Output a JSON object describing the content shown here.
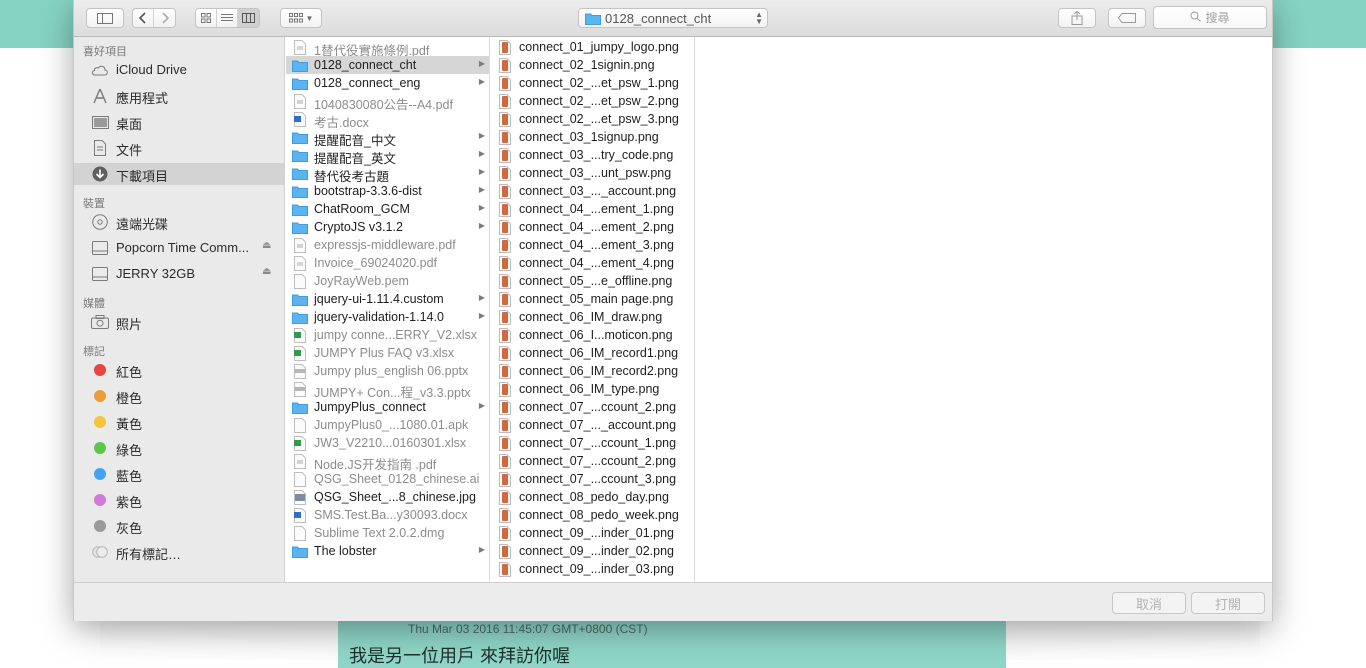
{
  "toolbar": {
    "path_label": "0128_connect_cht",
    "search_placeholder": "搜尋"
  },
  "sidebar": {
    "sections": [
      {
        "title": "喜好項目",
        "items": [
          {
            "label": "iCloud Drive",
            "icon": "cloud-icon"
          },
          {
            "label": "應用程式",
            "icon": "applications-icon"
          },
          {
            "label": "桌面",
            "icon": "desktop-icon"
          },
          {
            "label": "文件",
            "icon": "documents-icon"
          },
          {
            "label": "下載項目",
            "icon": "downloads-icon",
            "selected": true
          }
        ]
      },
      {
        "title": "裝置",
        "items": [
          {
            "label": "遠端光碟",
            "icon": "disc-icon"
          },
          {
            "label": "Popcorn Time Comm...",
            "icon": "drive-icon",
            "eject": true
          },
          {
            "label": "JERRY 32GB",
            "icon": "drive-icon",
            "eject": true
          }
        ]
      },
      {
        "title": "媒體",
        "items": [
          {
            "label": "照片",
            "icon": "camera-icon"
          }
        ]
      },
      {
        "title": "標記",
        "items": [
          {
            "label": "紅色",
            "color": "#e5463f"
          },
          {
            "label": "橙色",
            "color": "#f09a3a"
          },
          {
            "label": "黃色",
            "color": "#f5c43a"
          },
          {
            "label": "綠色",
            "color": "#5ec64c"
          },
          {
            "label": "藍色",
            "color": "#45a3ef"
          },
          {
            "label": "紫色",
            "color": "#d27ad9"
          },
          {
            "label": "灰色",
            "color": "#9a9a9a"
          },
          {
            "label": "所有標記…",
            "icon": "all-tags-icon"
          }
        ]
      }
    ]
  },
  "column1": [
    {
      "name": "1替代役實施條例.pdf",
      "type": "pdf",
      "dim": true
    },
    {
      "name": "0128_connect_cht",
      "type": "folder",
      "selected": true
    },
    {
      "name": "0128_connect_eng",
      "type": "folder"
    },
    {
      "name": "1040830080公告--A4.pdf",
      "type": "pdf",
      "dim": true
    },
    {
      "name": "考古.docx",
      "type": "docx",
      "dim": true
    },
    {
      "name": "提醒配音_中文",
      "type": "folder"
    },
    {
      "name": "提醒配音_英文",
      "type": "folder"
    },
    {
      "name": "替代役考古題",
      "type": "folder"
    },
    {
      "name": "bootstrap-3.3.6-dist",
      "type": "folder"
    },
    {
      "name": "ChatRoom_GCM",
      "type": "folder"
    },
    {
      "name": "CryptoJS v3.1.2",
      "type": "folder"
    },
    {
      "name": "expressjs-middleware.pdf",
      "type": "pdf",
      "dim": true
    },
    {
      "name": "Invoice_69024020.pdf",
      "type": "pdf",
      "dim": true
    },
    {
      "name": "JoyRayWeb.pem",
      "type": "file",
      "dim": true
    },
    {
      "name": "jquery-ui-1.11.4.custom",
      "type": "folder"
    },
    {
      "name": "jquery-validation-1.14.0",
      "type": "folder"
    },
    {
      "name": "jumpy conne...ERRY_V2.xlsx",
      "type": "xlsx",
      "dim": true
    },
    {
      "name": "JUMPY Plus FAQ v3.xlsx",
      "type": "xlsx",
      "dim": true
    },
    {
      "name": "Jumpy plus_english 06.pptx",
      "type": "pptx",
      "dim": true
    },
    {
      "name": "JUMPY+ Con...程_v3.3.pptx",
      "type": "pptx",
      "dim": true
    },
    {
      "name": "JumpyPlus_connect",
      "type": "folder"
    },
    {
      "name": "JumpyPlus0_...1080.01.apk",
      "type": "file",
      "dim": true
    },
    {
      "name": "JW3_V2210...0160301.xlsx",
      "type": "xlsx",
      "dim": true
    },
    {
      "name": "Node.JS开发指南 .pdf",
      "type": "pdf",
      "dim": true
    },
    {
      "name": "QSG_Sheet_0128_chinese.ai",
      "type": "file",
      "dim": true
    },
    {
      "name": "QSG_Sheet_...8_chinese.jpg",
      "type": "image"
    },
    {
      "name": "SMS.Test.Ba...y30093.docx",
      "type": "docx",
      "dim": true
    },
    {
      "name": "Sublime Text 2.0.2.dmg",
      "type": "file",
      "dim": true
    },
    {
      "name": "The lobster",
      "type": "folder"
    }
  ],
  "column2": [
    "connect_01_jumpy_logo.png",
    "connect_02_1signin.png",
    "connect_02_...et_psw_1.png",
    "connect_02_...et_psw_2.png",
    "connect_02_...et_psw_3.png",
    "connect_03_1signup.png",
    "connect_03_...try_code.png",
    "connect_03_...unt_psw.png",
    "connect_03_..._account.png",
    "connect_04_...ement_1.png",
    "connect_04_...ement_2.png",
    "connect_04_...ement_3.png",
    "connect_04_...ement_4.png",
    "connect_05_...e_offline.png",
    "connect_05_main page.png",
    "connect_06_IM_draw.png",
    "connect_06_I...moticon.png",
    "connect_06_IM_record1.png",
    "connect_06_IM_record2.png",
    "connect_06_IM_type.png",
    "connect_07_...ccount_2.png",
    "connect_07_..._account.png",
    "connect_07_...ccount_1.png",
    "connect_07_...ccount_2.png",
    "connect_07_...ccount_3.png",
    "connect_08_pedo_day.png",
    "connect_08_pedo_week.png",
    "connect_09_...inder_01.png",
    "connect_09_...inder_02.png",
    "connect_09_...inder_03.png"
  ],
  "footer": {
    "cancel_label": "取消",
    "open_label": "打開"
  },
  "background": {
    "timestamp": "Thu Mar 03 2016 11:45:07 GMT+0800 (CST)",
    "message": "我是另一位用戶 來拜訪你喔"
  }
}
